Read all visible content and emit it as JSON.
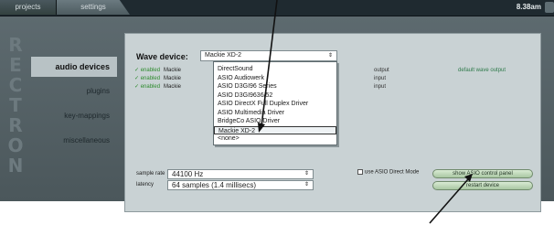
{
  "tabs": [
    {
      "label": "projects"
    },
    {
      "label": "settings"
    }
  ],
  "clock": "8.38am",
  "brand_letters": [
    "R",
    "E",
    "C",
    "T",
    "R",
    "O",
    "N"
  ],
  "nav": {
    "items": [
      {
        "label": "audio devices",
        "active": true
      },
      {
        "label": "plugins",
        "active": false
      },
      {
        "label": "key-mappings",
        "active": false
      },
      {
        "label": "miscellaneous",
        "active": false
      }
    ]
  },
  "wave": {
    "label": "Wave device:",
    "selected": "Mackie XD-2",
    "options": [
      "DirectSound",
      "ASIO Audiowerk",
      "ASIO D3GI96 Series",
      "ASIO D3GI9636/52",
      "ASIO DirectX Full Duplex Driver",
      "ASIO Multimedia Driver",
      "BridgeCo ASIO Driver",
      "Mackie XD-2",
      "<none>"
    ]
  },
  "device_table": {
    "rows": [
      {
        "enabled": "✓ enabled",
        "name": "Mackie",
        "io": "output",
        "default": "default wave output"
      },
      {
        "enabled": "✓ enabled",
        "name": "Mackie",
        "io": "input",
        "default": ""
      },
      {
        "enabled": "✓ enabled",
        "name": "Mackie",
        "io": "input",
        "default": ""
      }
    ]
  },
  "settings": {
    "sample_rate_label": "sample rate",
    "sample_rate": "44100 Hz",
    "latency_label": "latency",
    "latency": "64 samples (1.4 millisecs)"
  },
  "asio_direct_label": "use ASIO Direct Mode",
  "buttons": {
    "asio_panel": "show ASIO control panel",
    "restart": "restart device"
  },
  "colors": {
    "accent_green": "#2e8b2e",
    "panel": "#c9d2d4",
    "topbar": "#1f2a30"
  }
}
